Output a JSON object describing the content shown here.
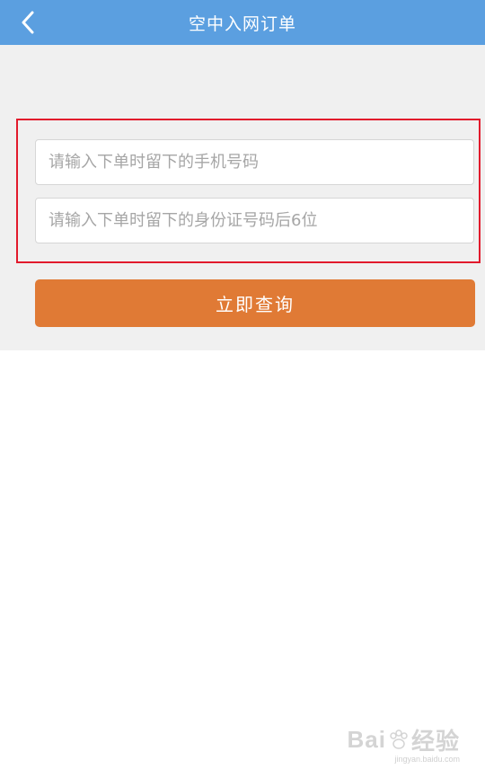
{
  "header": {
    "title": "空中入网订单",
    "back_icon": "chevron-left-icon"
  },
  "form": {
    "phone_placeholder": "请输入下单时留下的手机号码",
    "phone_value": "",
    "id_placeholder": "请输入下单时留下的身份证号码后6位",
    "id_value": "",
    "submit_label": "立即查询"
  },
  "colors": {
    "header_bg": "#5b9fe0",
    "button_bg": "#e07a35",
    "highlight_border": "#e21a2c"
  },
  "watermark": {
    "logo_text_left": "Bai",
    "logo_text_right": "经验",
    "url": "jingyan.baidu.com"
  }
}
